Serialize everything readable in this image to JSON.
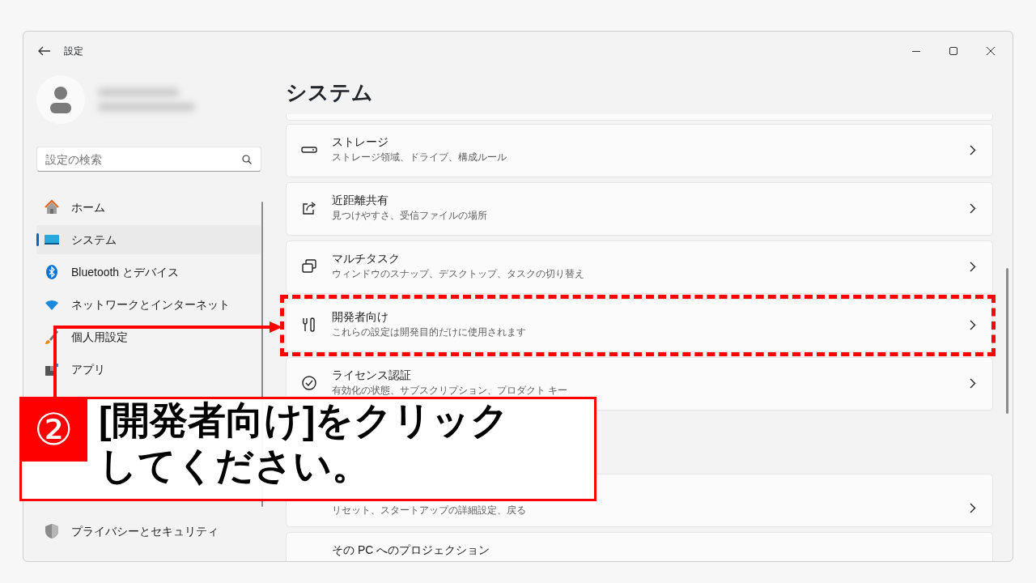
{
  "window": {
    "title": "設定"
  },
  "search": {
    "placeholder": "設定の検索"
  },
  "nav": [
    {
      "label": "ホーム",
      "selected": false
    },
    {
      "label": "システム",
      "selected": true
    },
    {
      "label": "Bluetooth とデバイス",
      "selected": false
    },
    {
      "label": "ネットワークとインターネット",
      "selected": false
    },
    {
      "label": "個人用設定",
      "selected": false
    },
    {
      "label": "アプリ",
      "selected": false
    }
  ],
  "nav_bottom": [
    {
      "label": "プライバシーとセキュリティ",
      "selected": false
    }
  ],
  "page_title": "システム",
  "cards": [
    {
      "title": "ストレージ",
      "subtitle": "ストレージ領域、ドライブ、構成ルール"
    },
    {
      "title": "近距離共有",
      "subtitle": "見つけやすさ、受信ファイルの場所"
    },
    {
      "title": "マルチタスク",
      "subtitle": "ウィンドウのスナップ、デスクトップ、タスクの切り替え"
    },
    {
      "title": "開発者向け",
      "subtitle": "これらの設定は開発目的だけに使用されます"
    },
    {
      "title": "ライセンス認証",
      "subtitle": "有効化の状態、サブスクリプション、プロダクト キー"
    }
  ],
  "cards_below": [
    {
      "subtitle": "リセット、スタートアップの詳細設定、戻る"
    },
    {
      "title": "その PC へのプロジェクション"
    }
  ],
  "annotation": {
    "step": "②",
    "lines": [
      "[開発者向け]をクリック",
      "してください。"
    ]
  }
}
